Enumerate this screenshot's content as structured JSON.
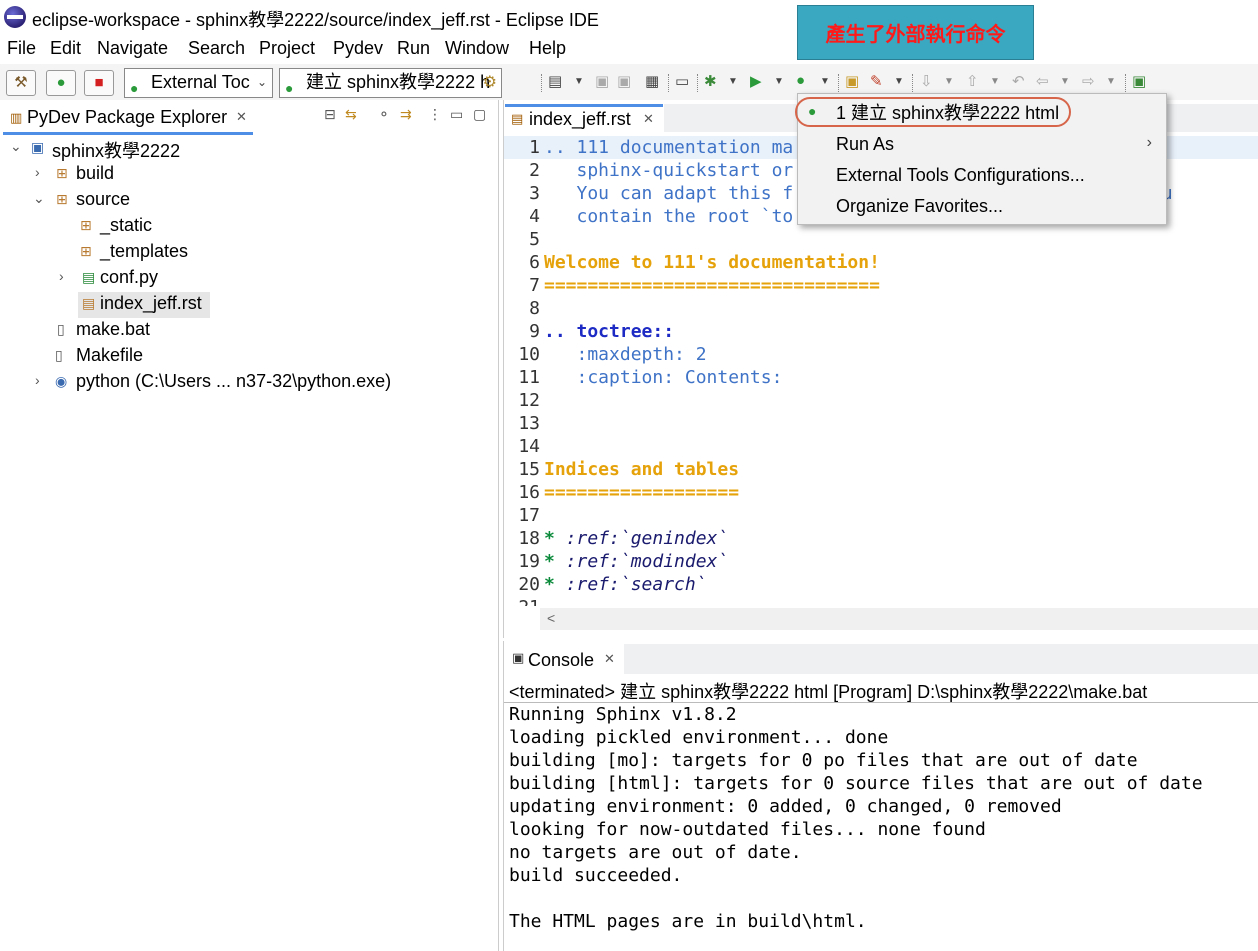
{
  "window": {
    "title": "eclipse-workspace - sphinx教學2222/source/index_jeff.rst - Eclipse IDE"
  },
  "annotation": {
    "text": "產生了外部執行命令"
  },
  "menubar": [
    "File",
    "Edit",
    "Navigate",
    "Search",
    "Project",
    "Pydev",
    "Run",
    "Window",
    "Help"
  ],
  "toolbar": {
    "combo1": "External Toc",
    "combo2": "建立 sphinx教學2222 h"
  },
  "explorer": {
    "tab_label": "PyDev Package Explorer",
    "tree": [
      {
        "label": "sphinx教學2222",
        "icon": "project-icon"
      },
      {
        "label": "build",
        "icon": "package-icon"
      },
      {
        "label": "source",
        "icon": "package-icon"
      },
      {
        "label": "_static",
        "icon": "package-icon"
      },
      {
        "label": "_templates",
        "icon": "package-icon"
      },
      {
        "label": "conf.py",
        "icon": "python-file-icon"
      },
      {
        "label": "index_jeff.rst",
        "icon": "rst-file-icon"
      },
      {
        "label": "make.bat",
        "icon": "file-icon"
      },
      {
        "label": "Makefile",
        "icon": "makefile-icon"
      },
      {
        "label": "python  (C:\\Users ... n37-32\\python.exe)",
        "icon": "python-interpreter-icon"
      }
    ]
  },
  "editor": {
    "tab_label": "index_jeff.rst",
    "lines": [
      {
        "n": "1",
        "text": ".. 111 documentation ma",
        "cls": "c-comment"
      },
      {
        "n": "2",
        "text": "   sphinx-quickstart or",
        "cls": "c-comment"
      },
      {
        "n": "3",
        "text": "   You can adapt this f                          t it shou",
        "cls": "c-comment"
      },
      {
        "n": "4",
        "text": "   contain the root `to",
        "cls": "c-comment"
      },
      {
        "n": "5",
        "text": "",
        "cls": ""
      },
      {
        "n": "6",
        "text": "Welcome to 111's documentation!",
        "cls": "c-head"
      },
      {
        "n": "7",
        "text": "===============================",
        "cls": "c-head"
      },
      {
        "n": "8",
        "text": "",
        "cls": ""
      },
      {
        "n": "9",
        "text": ".. toctree::",
        "cls": "c-dir"
      },
      {
        "n": "10",
        "text": "   :maxdepth: 2",
        "cls": "c-opt"
      },
      {
        "n": "11",
        "text": "   :caption: Contents:",
        "cls": "c-opt"
      },
      {
        "n": "12",
        "text": "",
        "cls": ""
      },
      {
        "n": "13",
        "text": "",
        "cls": ""
      },
      {
        "n": "14",
        "text": "",
        "cls": ""
      },
      {
        "n": "15",
        "text": "Indices and tables",
        "cls": "c-head"
      },
      {
        "n": "16",
        "text": "==================",
        "cls": "c-head"
      },
      {
        "n": "17",
        "text": "",
        "cls": ""
      },
      {
        "n": "18",
        "text": "* :ref:`genindex`",
        "cls": "c-ref"
      },
      {
        "n": "19",
        "text": "* :ref:`modindex`",
        "cls": "c-ref"
      },
      {
        "n": "20",
        "text": "* :ref:`search`",
        "cls": "c-ref"
      },
      {
        "n": "21",
        "text": "",
        "cls": ""
      }
    ]
  },
  "dropdown": {
    "items": [
      "1 建立 sphinx教學2222 html",
      "Run As",
      "External Tools Configurations...",
      "Organize Favorites..."
    ]
  },
  "console": {
    "tab_label": "Console",
    "status": "<terminated> 建立 sphinx教學2222 html [Program] D:\\sphinx教學2222\\make.bat",
    "output": [
      "Running Sphinx v1.8.2",
      "loading pickled environment... done",
      "building [mo]: targets for 0 po files that are out of date",
      "building [html]: targets for 0 source files that are out of date",
      "updating environment: 0 added, 0 changed, 0 removed",
      "looking for now-outdated files... none found",
      "no targets are out of date.",
      "build succeeded.",
      "",
      "The HTML pages are in build\\html."
    ]
  }
}
